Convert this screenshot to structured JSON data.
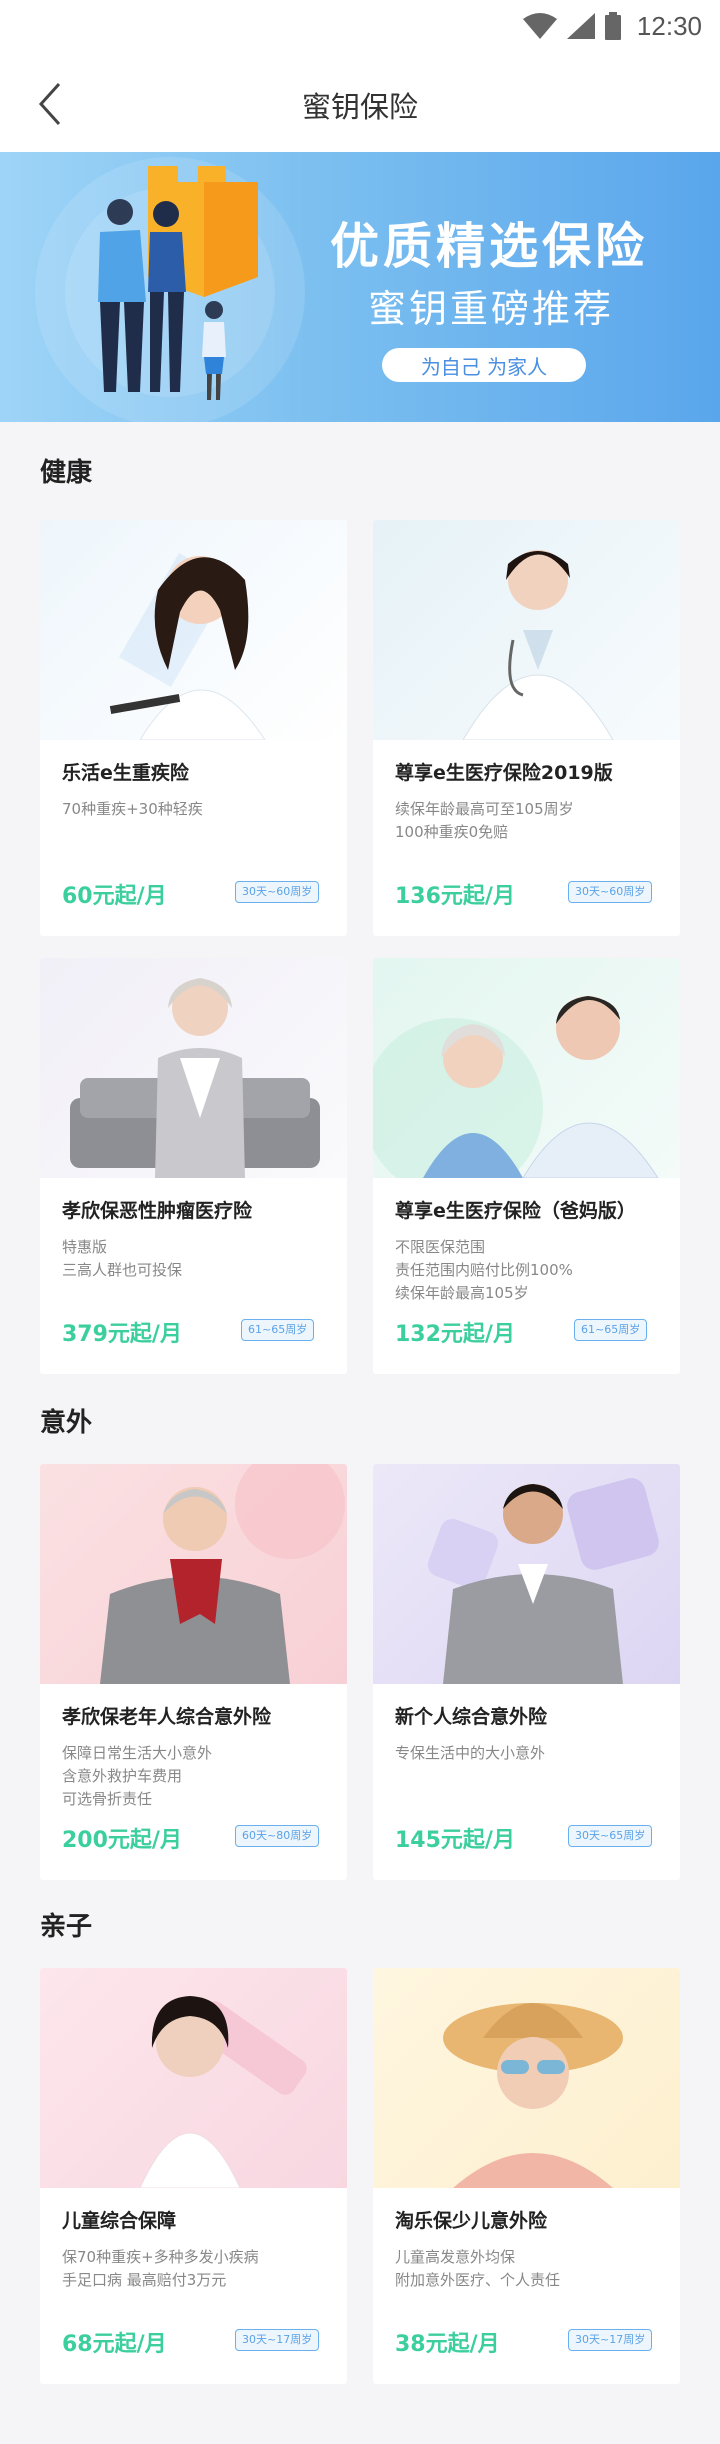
{
  "status_bar": {
    "time": "12:30",
    "icons": [
      "wifi-icon",
      "signal-icon",
      "battery-icon"
    ]
  },
  "header": {
    "title": "蜜钥保险",
    "back_icon": "chevron-left-icon"
  },
  "banner": {
    "title": "优质精选保险",
    "subtitle": "蜜钥重磅推荐",
    "button": "为自己 为家人"
  },
  "colors": {
    "accent_green": "#3ccf9e",
    "tag_blue": "#5aa2e6",
    "banner_blue": "#7bbff0"
  },
  "sections": [
    {
      "title": "健康",
      "cards": [
        {
          "name": "乐活e生重疾险",
          "desc": [
            "70种重疾+30种轻疾"
          ],
          "price": "60元起/月",
          "tag": "30天~60周岁"
        },
        {
          "name": "尊享e生医疗保险2019版",
          "desc": [
            "续保年龄最高可至105周岁",
            "100种重疾0免赔"
          ],
          "price": "136元起/月",
          "tag": "30天~60周岁"
        },
        {
          "name": "孝欣保恶性肿瘤医疗险",
          "desc": [
            "特惠版",
            "三高人群也可投保"
          ],
          "price": "379元起/月",
          "tag": "61~65周岁"
        },
        {
          "name": "尊享e生医疗保险（爸妈版）",
          "desc": [
            "不限医保范围",
            "责任范围内赔付比例100%",
            "续保年龄最高105岁"
          ],
          "price": "132元起/月",
          "tag": "61~65周岁"
        }
      ]
    },
    {
      "title": "意外",
      "cards": [
        {
          "name": "孝欣保老年人综合意外险",
          "desc": [
            "保障日常生活大小意外",
            "含意外救护车费用",
            "可选骨折责任"
          ],
          "price": "200元起/月",
          "tag": "60天~80周岁"
        },
        {
          "name": "新个人综合意外险",
          "desc": [
            "专保生活中的大小意外"
          ],
          "price": "145元起/月",
          "tag": "30天~65周岁"
        }
      ]
    },
    {
      "title": "亲子",
      "cards": [
        {
          "name": "儿童综合保障",
          "desc": [
            "保70种重疾+多种多发小疾病",
            "手足口病 最高赔付3万元"
          ],
          "price": "68元起/月",
          "tag": "30天~17周岁"
        },
        {
          "name": "淘乐保少儿意外险",
          "desc": [
            "儿童高发意外均保",
            "附加意外医疗、个人责任"
          ],
          "price": "38元起/月",
          "tag": "30天~17周岁"
        }
      ]
    }
  ]
}
